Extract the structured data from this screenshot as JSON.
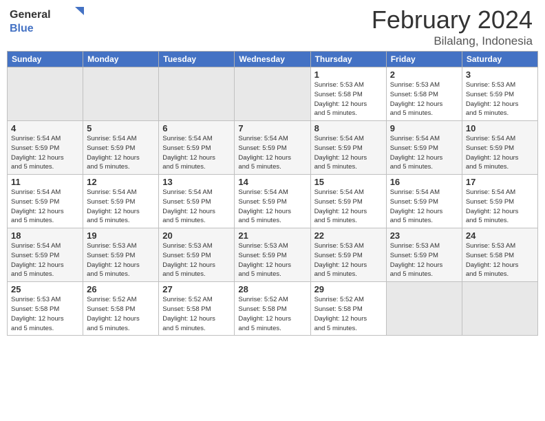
{
  "header": {
    "logo_general": "General",
    "logo_blue": "Blue",
    "month_title": "February 2024",
    "location": "Bilalang, Indonesia"
  },
  "weekdays": [
    "Sunday",
    "Monday",
    "Tuesday",
    "Wednesday",
    "Thursday",
    "Friday",
    "Saturday"
  ],
  "rows": [
    [
      {
        "day": "",
        "info": ""
      },
      {
        "day": "",
        "info": ""
      },
      {
        "day": "",
        "info": ""
      },
      {
        "day": "",
        "info": ""
      },
      {
        "day": "1",
        "info": "Sunrise: 5:53 AM\nSunset: 5:58 PM\nDaylight: 12 hours\nand 5 minutes."
      },
      {
        "day": "2",
        "info": "Sunrise: 5:53 AM\nSunset: 5:58 PM\nDaylight: 12 hours\nand 5 minutes."
      },
      {
        "day": "3",
        "info": "Sunrise: 5:53 AM\nSunset: 5:59 PM\nDaylight: 12 hours\nand 5 minutes."
      }
    ],
    [
      {
        "day": "4",
        "info": "Sunrise: 5:54 AM\nSunset: 5:59 PM\nDaylight: 12 hours\nand 5 minutes."
      },
      {
        "day": "5",
        "info": "Sunrise: 5:54 AM\nSunset: 5:59 PM\nDaylight: 12 hours\nand 5 minutes."
      },
      {
        "day": "6",
        "info": "Sunrise: 5:54 AM\nSunset: 5:59 PM\nDaylight: 12 hours\nand 5 minutes."
      },
      {
        "day": "7",
        "info": "Sunrise: 5:54 AM\nSunset: 5:59 PM\nDaylight: 12 hours\nand 5 minutes."
      },
      {
        "day": "8",
        "info": "Sunrise: 5:54 AM\nSunset: 5:59 PM\nDaylight: 12 hours\nand 5 minutes."
      },
      {
        "day": "9",
        "info": "Sunrise: 5:54 AM\nSunset: 5:59 PM\nDaylight: 12 hours\nand 5 minutes."
      },
      {
        "day": "10",
        "info": "Sunrise: 5:54 AM\nSunset: 5:59 PM\nDaylight: 12 hours\nand 5 minutes."
      }
    ],
    [
      {
        "day": "11",
        "info": "Sunrise: 5:54 AM\nSunset: 5:59 PM\nDaylight: 12 hours\nand 5 minutes."
      },
      {
        "day": "12",
        "info": "Sunrise: 5:54 AM\nSunset: 5:59 PM\nDaylight: 12 hours\nand 5 minutes."
      },
      {
        "day": "13",
        "info": "Sunrise: 5:54 AM\nSunset: 5:59 PM\nDaylight: 12 hours\nand 5 minutes."
      },
      {
        "day": "14",
        "info": "Sunrise: 5:54 AM\nSunset: 5:59 PM\nDaylight: 12 hours\nand 5 minutes."
      },
      {
        "day": "15",
        "info": "Sunrise: 5:54 AM\nSunset: 5:59 PM\nDaylight: 12 hours\nand 5 minutes."
      },
      {
        "day": "16",
        "info": "Sunrise: 5:54 AM\nSunset: 5:59 PM\nDaylight: 12 hours\nand 5 minutes."
      },
      {
        "day": "17",
        "info": "Sunrise: 5:54 AM\nSunset: 5:59 PM\nDaylight: 12 hours\nand 5 minutes."
      }
    ],
    [
      {
        "day": "18",
        "info": "Sunrise: 5:54 AM\nSunset: 5:59 PM\nDaylight: 12 hours\nand 5 minutes."
      },
      {
        "day": "19",
        "info": "Sunrise: 5:53 AM\nSunset: 5:59 PM\nDaylight: 12 hours\nand 5 minutes."
      },
      {
        "day": "20",
        "info": "Sunrise: 5:53 AM\nSunset: 5:59 PM\nDaylight: 12 hours\nand 5 minutes."
      },
      {
        "day": "21",
        "info": "Sunrise: 5:53 AM\nSunset: 5:59 PM\nDaylight: 12 hours\nand 5 minutes."
      },
      {
        "day": "22",
        "info": "Sunrise: 5:53 AM\nSunset: 5:59 PM\nDaylight: 12 hours\nand 5 minutes."
      },
      {
        "day": "23",
        "info": "Sunrise: 5:53 AM\nSunset: 5:59 PM\nDaylight: 12 hours\nand 5 minutes."
      },
      {
        "day": "24",
        "info": "Sunrise: 5:53 AM\nSunset: 5:58 PM\nDaylight: 12 hours\nand 5 minutes."
      }
    ],
    [
      {
        "day": "25",
        "info": "Sunrise: 5:53 AM\nSunset: 5:58 PM\nDaylight: 12 hours\nand 5 minutes."
      },
      {
        "day": "26",
        "info": "Sunrise: 5:52 AM\nSunset: 5:58 PM\nDaylight: 12 hours\nand 5 minutes."
      },
      {
        "day": "27",
        "info": "Sunrise: 5:52 AM\nSunset: 5:58 PM\nDaylight: 12 hours\nand 5 minutes."
      },
      {
        "day": "28",
        "info": "Sunrise: 5:52 AM\nSunset: 5:58 PM\nDaylight: 12 hours\nand 5 minutes."
      },
      {
        "day": "29",
        "info": "Sunrise: 5:52 AM\nSunset: 5:58 PM\nDaylight: 12 hours\nand 5 minutes."
      },
      {
        "day": "",
        "info": ""
      },
      {
        "day": "",
        "info": ""
      }
    ]
  ]
}
